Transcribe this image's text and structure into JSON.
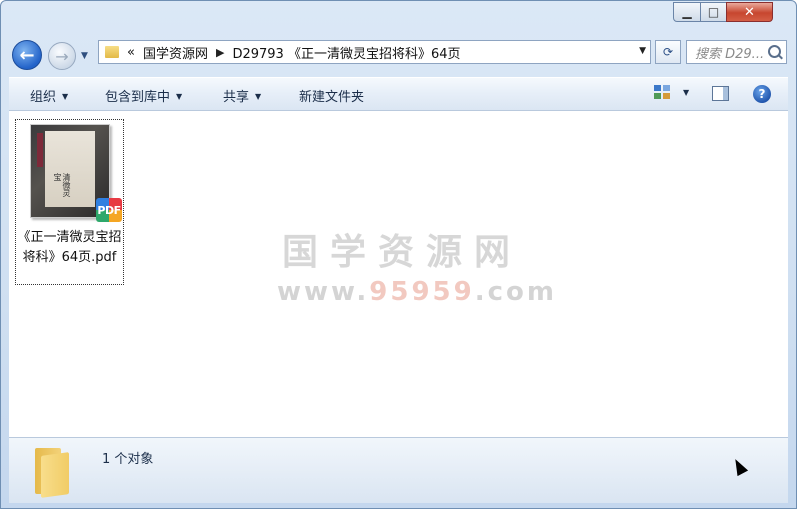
{
  "window": {
    "minimize": "▁",
    "maximize": "□",
    "close": "✕"
  },
  "nav": {
    "back": "←",
    "forward": "→",
    "refresh": "⟳",
    "breadcrumb_overflow": "«",
    "breadcrumb": [
      "国学资源网",
      "D29793 《正一清微灵宝招将科》64页"
    ],
    "search_placeholder": "搜索 D29..."
  },
  "toolbar": {
    "organize": "组织",
    "include_in_library": "包含到库中",
    "share": "共享",
    "new_folder": "新建文件夹",
    "help": "?"
  },
  "files": [
    {
      "name": "《正一清微灵宝招将科》64页.pdf",
      "badge": "PDF",
      "cover_text": "清微灵宝"
    }
  ],
  "watermark": {
    "line1": "国学资源网",
    "line2_prefix": "www.",
    "line2_highlight": "95959",
    "line2_suffix": ".com"
  },
  "status": {
    "text": "1 个对象"
  }
}
